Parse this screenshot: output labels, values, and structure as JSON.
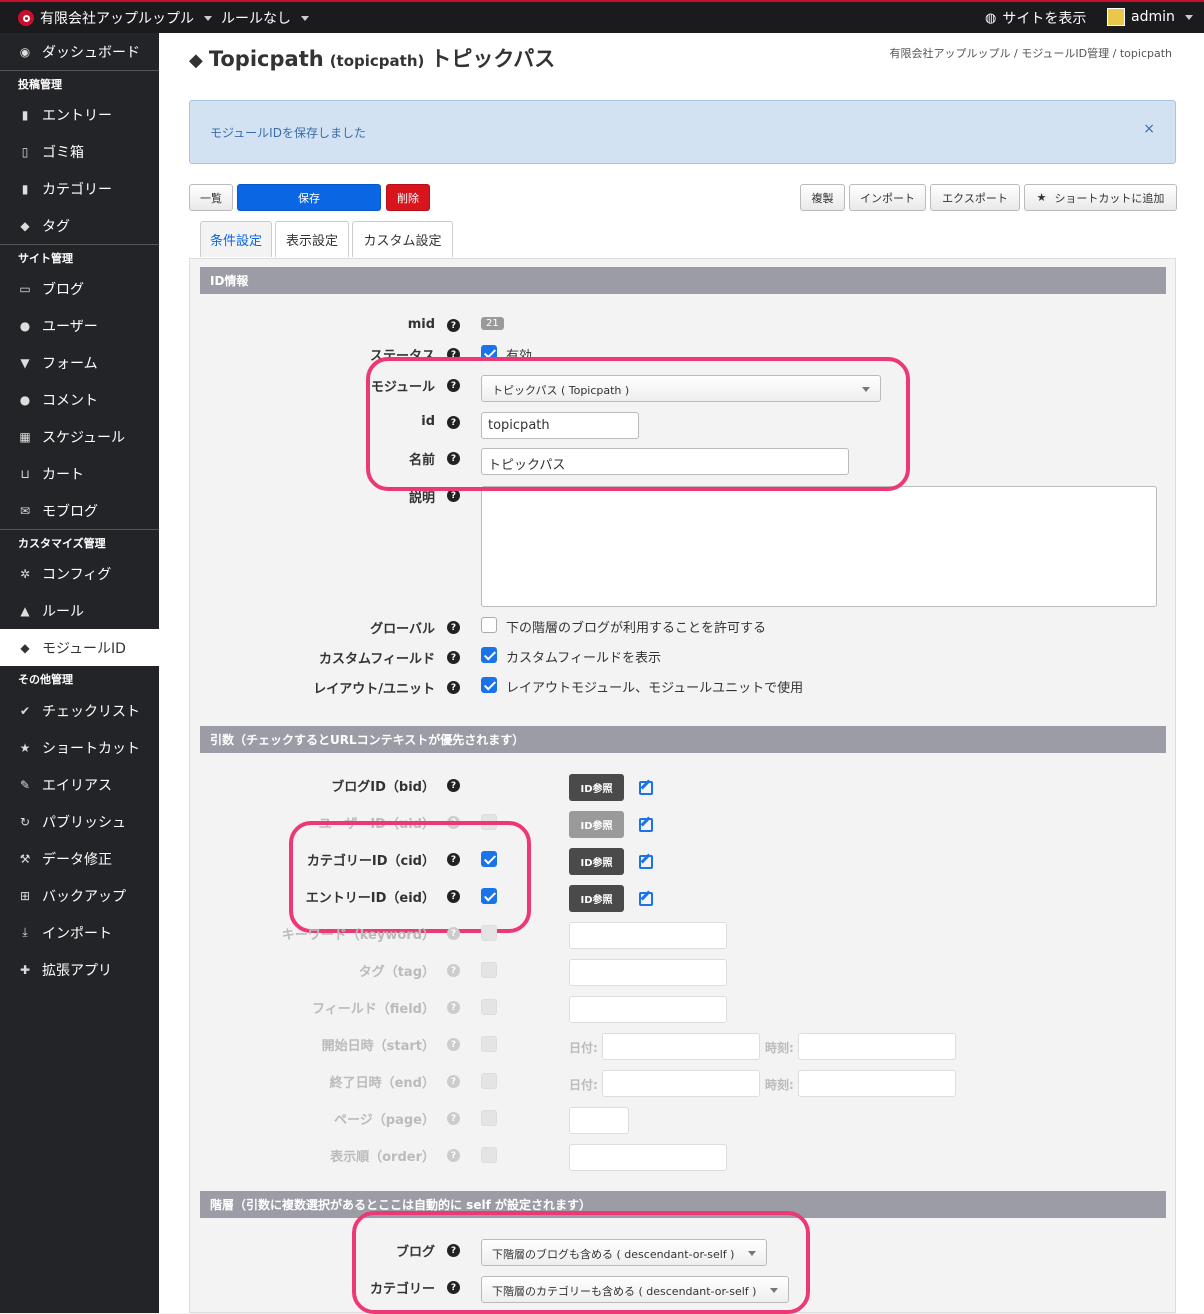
{
  "topbar": {
    "site": "有限会社アップルップル",
    "rule": "ルールなし",
    "view_site": "サイトを表示",
    "user": "admin"
  },
  "sidebar": {
    "dashboard": "ダッシュボード",
    "h1": "投稿管理",
    "entry": "エントリー",
    "trash": "ゴミ箱",
    "category": "カテゴリー",
    "tag": "タグ",
    "h2": "サイト管理",
    "blog": "ブログ",
    "user": "ユーザー",
    "form": "フォーム",
    "comment": "コメント",
    "schedule": "スケジュール",
    "cart": "カート",
    "moblog": "モブログ",
    "h3": "カスタマイズ管理",
    "config": "コンフィグ",
    "rule": "ルール",
    "module": "モジュールID",
    "h4": "その他管理",
    "checklist": "チェックリスト",
    "shortcut": "ショートカット",
    "alias": "エイリアス",
    "publish": "パブリッシュ",
    "data_fix": "データ修正",
    "backup": "バックアップ",
    "import": "インポート",
    "ext": "拡張アプリ"
  },
  "header": {
    "title": "Topicpath",
    "id": "(topicpath)",
    "name": "トピックパス",
    "breadcrumb": [
      "有限会社アップルップル",
      "モジュールID管理",
      "topicpath"
    ]
  },
  "alert": {
    "message": "モジュールIDを保存しました",
    "close": "×"
  },
  "toolbar": {
    "list": "一覧",
    "save": "保存",
    "delete": "削除",
    "duplicate": "複製",
    "import": "インポート",
    "export": "エクスポート",
    "shortcut": "ショートカットに追加"
  },
  "tabs": [
    "条件設定",
    "表示設定",
    "カスタム設定"
  ],
  "id_info": {
    "section": "ID情報",
    "mid_label": "mid",
    "mid_value": "21",
    "status_label": "ステータス",
    "status_text": "有効",
    "module_label": "モジュール",
    "module_value": "トピックパス ( Topicpath )",
    "id_label": "id",
    "id_value": "topicpath",
    "name_label": "名前",
    "name_value": "トピックパス",
    "desc_label": "説明",
    "global_label": "グローバル",
    "global_text": "下の階層のブログが利用することを許可する",
    "cf_label": "カスタムフィールド",
    "cf_text": "カスタムフィールドを表示",
    "layout_label": "レイアウト/ユニット",
    "layout_text": "レイアウトモジュール、モジュールユニットで使用"
  },
  "args": {
    "section": "引数（チェックするとURLコンテキストが優先されます）",
    "bid": "ブログID（bid）",
    "uid": "ユーザーID（uid）",
    "cid": "カテゴリーID（cid）",
    "eid": "エントリーID（eid）",
    "keyword": "キーワード（keyword）",
    "tag": "タグ（tag）",
    "field": "フィールド（field）",
    "start": "開始日時（start）",
    "end": "終了日時（end）",
    "page": "ページ（page）",
    "order": "表示順（order）",
    "id_ref": "ID参照",
    "date": "日付:",
    "time": "時刻:"
  },
  "hierarchy": {
    "section": "階層（引数に複数選択があるとここは自動的に self が設定されます）",
    "blog_label": "ブログ",
    "blog_value": "下階層のブログも含める ( descendant-or-self )",
    "cat_label": "カテゴリー",
    "cat_value": "下階層のカテゴリーも含める ( descendant-or-self )"
  },
  "colors": {
    "accent": "#0b66e4",
    "danger": "#d8141d",
    "highlight": "#ec3975",
    "sidebar": "#232428"
  }
}
